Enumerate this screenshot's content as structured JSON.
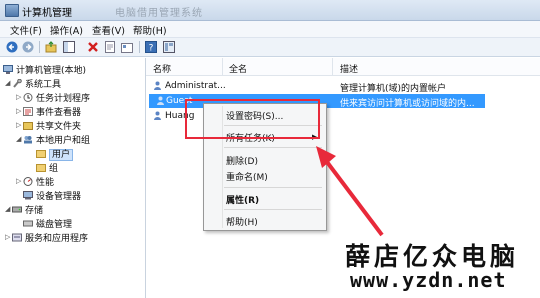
{
  "window": {
    "title": "计算机管理",
    "blurred_title": "电脑借用管理系统"
  },
  "menu": [
    "文件(F)",
    "操作(A)",
    "查看(V)",
    "帮助(H)"
  ],
  "toolbar": {
    "icons": [
      "back-arrow-icon",
      "forward-arrow-icon",
      "up-folder-icon",
      "show-hide-tree-icon",
      "delete-icon",
      "properties-icon",
      "export-list-icon",
      "help-icon",
      "mmc-icon"
    ]
  },
  "tree": {
    "root": "计算机管理(本地)",
    "items": [
      {
        "label": "系统工具"
      },
      {
        "label": "任务计划程序"
      },
      {
        "label": "事件查看器"
      },
      {
        "label": "共享文件夹"
      },
      {
        "label": "本地用户和组"
      },
      {
        "label": "用户"
      },
      {
        "label": "组"
      },
      {
        "label": "性能"
      },
      {
        "label": "设备管理器"
      },
      {
        "label": "存储"
      },
      {
        "label": "磁盘管理"
      },
      {
        "label": "服务和应用程序"
      }
    ]
  },
  "list": {
    "headers": [
      "名称",
      "全名",
      "描述"
    ],
    "rows": [
      {
        "name": "Administrat...",
        "fullname": "",
        "description": "管理计算机(域)的内置帐户"
      },
      {
        "name": "Guest",
        "fullname": "",
        "description": "供来宾访问计算机或访问域的内..."
      },
      {
        "name": "Huang",
        "fullname": "",
        "description": ""
      }
    ]
  },
  "context_menu": {
    "set_password": "设置密码(S)...",
    "all_tasks": "所有任务(K)",
    "delete": "删除(D)",
    "rename": "重命名(M)",
    "properties": "属性(R)",
    "help": "帮助(H)"
  },
  "watermark": {
    "text": "薛店亿众电脑",
    "url": "www.yzdn.net"
  },
  "colors": {
    "highlight": "#3399ff",
    "annotation": "#e8293a"
  }
}
